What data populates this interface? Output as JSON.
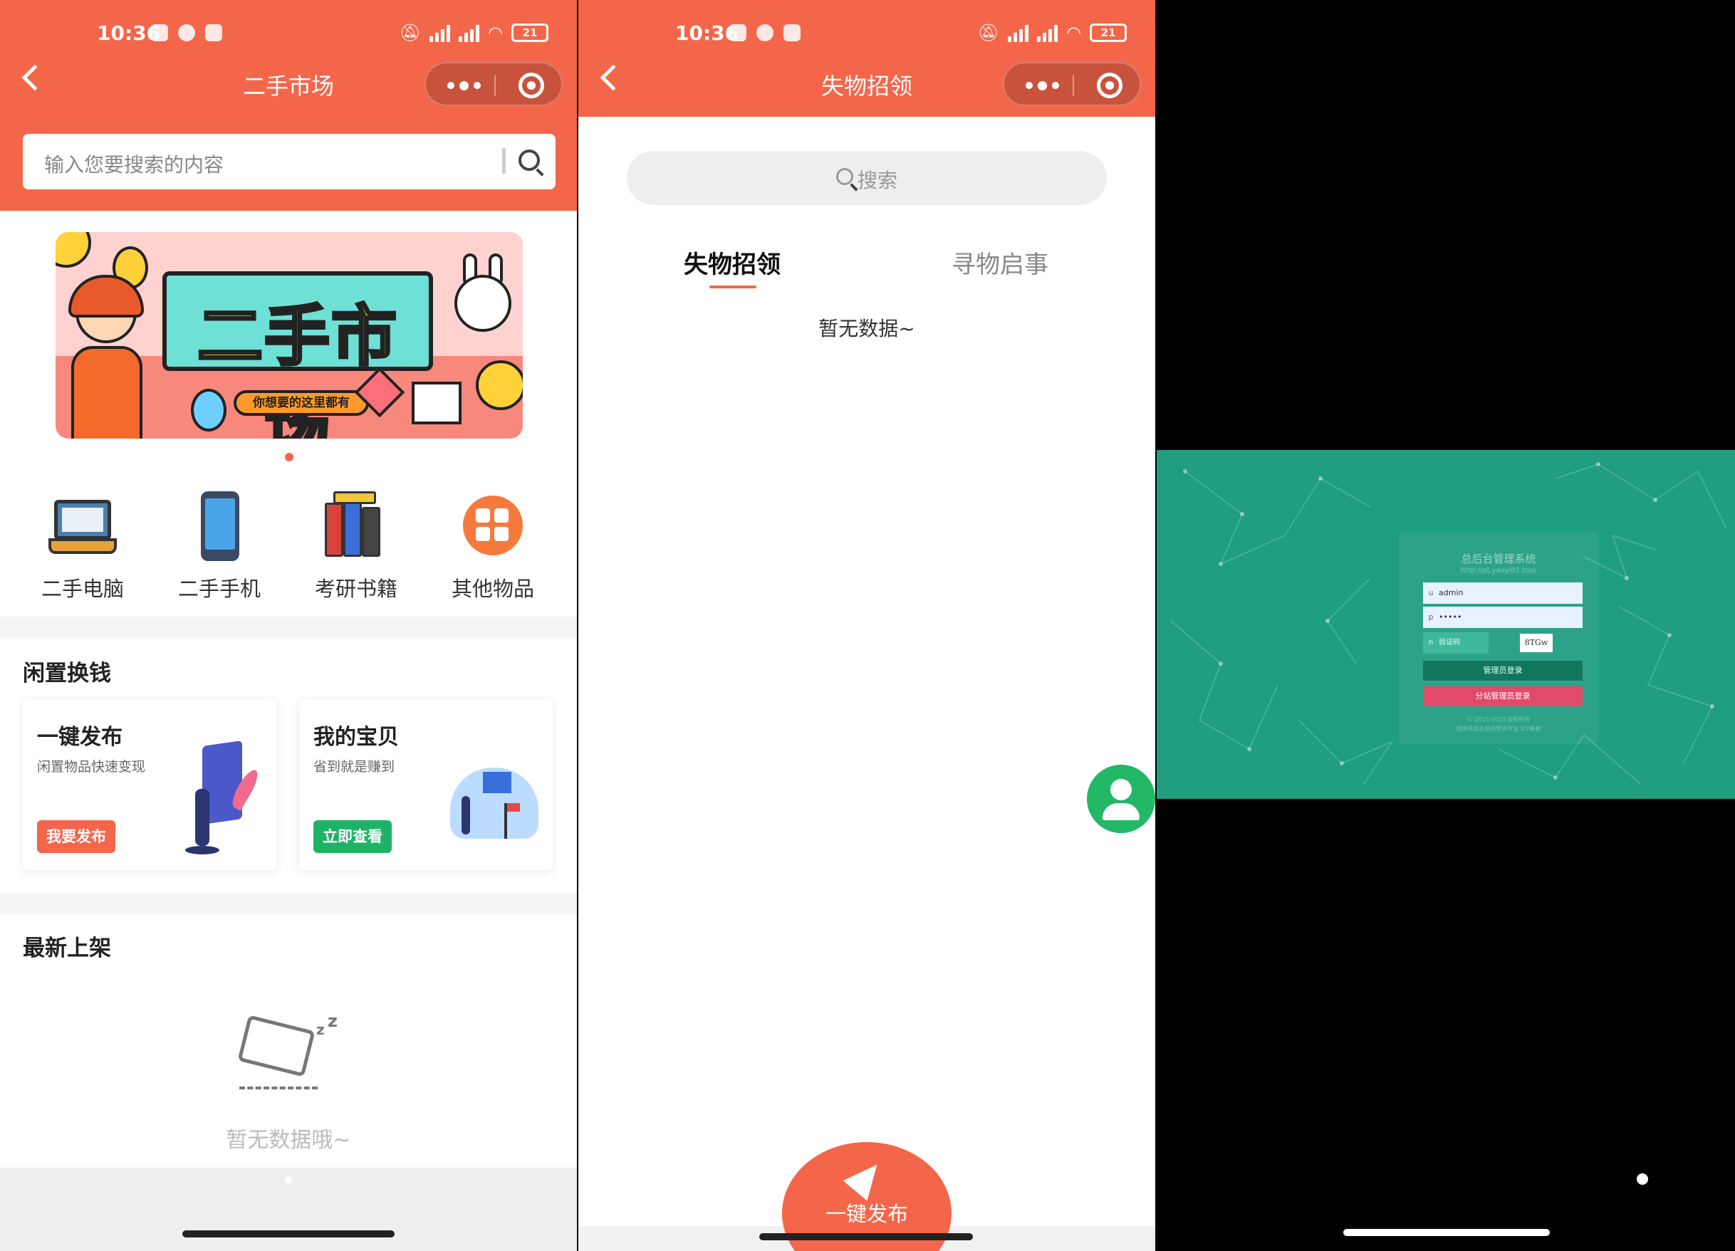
{
  "status_bar": {
    "time": "10:36",
    "battery": "21"
  },
  "colors": {
    "brand": "#f4664a",
    "green": "#22b866",
    "admin_bg": "#1f9e82"
  },
  "market": {
    "title": "二手市场",
    "search_placeholder": "输入您要搜索的内容",
    "banner": {
      "headline": "二手市场",
      "tag": "你想要的这里都有"
    },
    "categories": [
      {
        "label": "二手电脑",
        "icon": "laptop-icon"
      },
      {
        "label": "二手手机",
        "icon": "phone-icon"
      },
      {
        "label": "考研书籍",
        "icon": "books-icon"
      },
      {
        "label": "其他物品",
        "icon": "grid-icon"
      }
    ],
    "section_idle": "闲置换钱",
    "cards": [
      {
        "title": "一键发布",
        "subtitle": "闲置物品快速变现",
        "button": "我要发布",
        "button_color": "#f4664a"
      },
      {
        "title": "我的宝贝",
        "subtitle": "省到就是赚到",
        "button": "立即查看",
        "button_color": "#1fb266"
      }
    ],
    "section_new": "最新上架",
    "empty": "暂无数据哦~"
  },
  "lost_found": {
    "title": "失物招领",
    "search_label": "搜索",
    "tabs": [
      {
        "label": "失物招领",
        "active": true
      },
      {
        "label": "寻物启事",
        "active": false
      }
    ],
    "empty": "暂无数据~",
    "publish_button": "一键发布"
  },
  "admin_login": {
    "system_title": "总后台管理系统",
    "url_text": "http://pt.yaoyi01.top/",
    "username_prefix": "u",
    "username": "admin",
    "password_prefix": "p",
    "password": "•••••",
    "captcha_prefix": "n",
    "captcha_placeholder": "验证码",
    "captcha_code": "8TGw",
    "admin_login_button": "管理员登录",
    "branch_login_button": "分站管理员登录",
    "footer_line1": "© 2015-2019 版权所有",
    "footer_line2": "增值电信业务经营许可证 ICP备案"
  }
}
